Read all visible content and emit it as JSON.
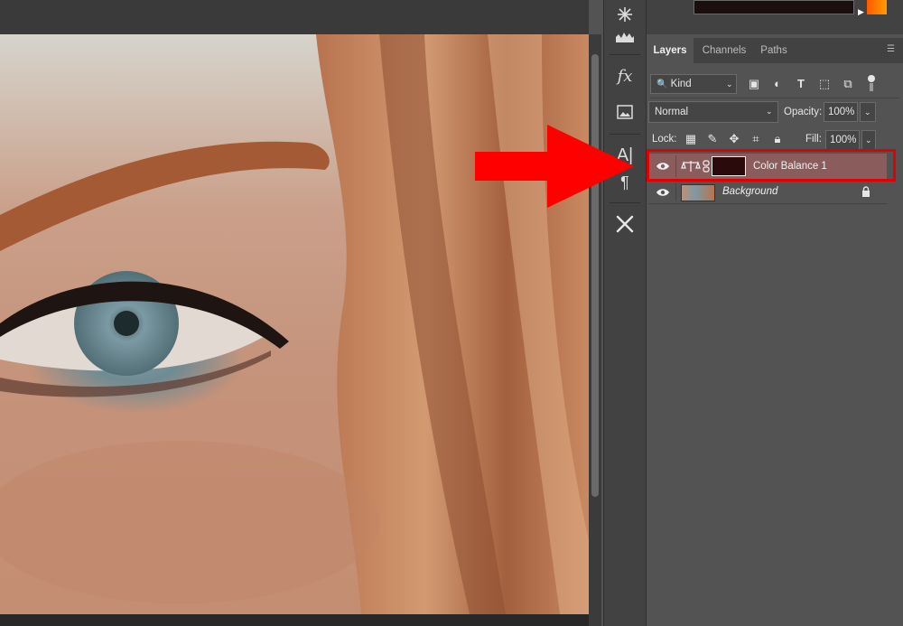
{
  "layers_panel": {
    "tabs": [
      {
        "label": "Layers",
        "active": true
      },
      {
        "label": "Channels",
        "active": false
      },
      {
        "label": "Paths",
        "active": false
      }
    ],
    "filter": {
      "label": "Kind"
    },
    "blend_mode": "Normal",
    "opacity_label": "Opacity:",
    "opacity_value": "100%",
    "lock_label": "Lock:",
    "fill_label": "Fill:",
    "fill_value": "100%",
    "layers": [
      {
        "name": "Color Balance 1",
        "type": "adjustment",
        "selected": true,
        "visible": true
      },
      {
        "name": "Background",
        "type": "pixel",
        "selected": false,
        "visible": true,
        "locked": true
      }
    ]
  },
  "tool_column": {
    "icons": [
      "asterisk-icon",
      "histogram-icon",
      "fx-icon",
      "image-layer-icon",
      "character-icon",
      "paragraph-icon",
      "tools-icon"
    ]
  },
  "colors": {
    "selected_layer": "#8a5c5c",
    "highlight_box": "#e10000",
    "arrow": "#ff0000",
    "panel_bg": "#535353"
  }
}
